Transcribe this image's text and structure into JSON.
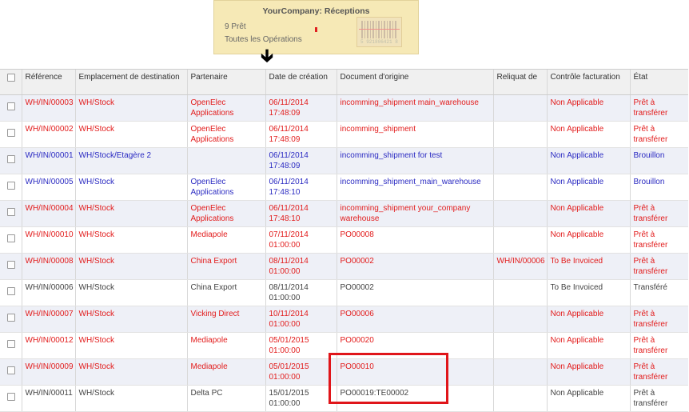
{
  "card": {
    "title": "YourCompany: Réceptions",
    "ready": "9 Prêt",
    "all_ops": "Toutes les Opérations",
    "barcode_number": "5 921806421 8"
  },
  "table": {
    "headers": {
      "reference": "Référence",
      "destination": "Emplacement de destination",
      "partner": "Partenaire",
      "created": "Date de création",
      "origin": "Document d'origine",
      "backorder": "Reliquat de",
      "invoice": "Contrôle facturation",
      "state": "État"
    },
    "rows": [
      {
        "color": "red",
        "reference": "WH/IN/00003",
        "destination": "WH/Stock",
        "partner": "OpenElec Applications",
        "created": "06/11/2014 17:48:09",
        "origin": "incomming_shipment main_warehouse",
        "backorder": "",
        "invoice": "Non Applicable",
        "state": "Prêt à transférer"
      },
      {
        "color": "red",
        "reference": "WH/IN/00002",
        "destination": "WH/Stock",
        "partner": "OpenElec Applications",
        "created": "06/11/2014 17:48:09",
        "origin": "incomming_shipment",
        "backorder": "",
        "invoice": "Non Applicable",
        "state": "Prêt à transférer"
      },
      {
        "color": "blue",
        "reference": "WH/IN/00001",
        "destination": "WH/Stock/Etagère 2",
        "partner": "",
        "created": "06/11/2014 17:48:09",
        "origin": "incomming_shipment for test",
        "backorder": "",
        "invoice": "Non Applicable",
        "state": "Brouillon"
      },
      {
        "color": "blue",
        "reference": "WH/IN/00005",
        "destination": "WH/Stock",
        "partner": "OpenElec Applications",
        "created": "06/11/2014 17:48:10",
        "origin": "incomming_shipment_main_warehouse",
        "backorder": "",
        "invoice": "Non Applicable",
        "state": "Brouillon"
      },
      {
        "color": "red",
        "reference": "WH/IN/00004",
        "destination": "WH/Stock",
        "partner": "OpenElec Applications",
        "created": "06/11/2014 17:48:10",
        "origin": "incomming_shipment your_company warehouse",
        "backorder": "",
        "invoice": "Non Applicable",
        "state": "Prêt à transférer"
      },
      {
        "color": "red",
        "reference": "WH/IN/00010",
        "destination": "WH/Stock",
        "partner": "Mediapole",
        "created": "07/11/2014 01:00:00",
        "origin": "PO00008",
        "backorder": "",
        "invoice": "Non Applicable",
        "state": "Prêt à transférer"
      },
      {
        "color": "red",
        "reference": "WH/IN/00008",
        "destination": "WH/Stock",
        "partner": "China Export",
        "created": "08/11/2014 01:00:00",
        "origin": "PO00002",
        "backorder": "WH/IN/00006",
        "invoice": "To Be Invoiced",
        "state": "Prêt à transférer"
      },
      {
        "color": "gray",
        "reference": "WH/IN/00006",
        "destination": "WH/Stock",
        "partner": "China Export",
        "created": "08/11/2014 01:00:00",
        "origin": "PO00002",
        "backorder": "",
        "invoice": "To Be Invoiced",
        "state": "Transféré"
      },
      {
        "color": "red",
        "reference": "WH/IN/00007",
        "destination": "WH/Stock",
        "partner": "Vicking Direct",
        "created": "10/11/2014 01:00:00",
        "origin": "PO00006",
        "backorder": "",
        "invoice": "Non Applicable",
        "state": "Prêt à transférer"
      },
      {
        "color": "red",
        "reference": "WH/IN/00012",
        "destination": "WH/Stock",
        "partner": "Mediapole",
        "created": "05/01/2015 01:00:00",
        "origin": "PO00020",
        "backorder": "",
        "invoice": "Non Applicable",
        "state": "Prêt à transférer"
      },
      {
        "color": "red",
        "reference": "WH/IN/00009",
        "destination": "WH/Stock",
        "partner": "Mediapole",
        "created": "05/01/2015 01:00:00",
        "origin": "PO00010",
        "backorder": "",
        "invoice": "Non Applicable",
        "state": "Prêt à transférer"
      },
      {
        "color": "gray",
        "reference": "WH/IN/00011",
        "destination": "WH/Stock",
        "partner": "Delta PC",
        "created": "15/01/2015 01:00:00",
        "origin": "PO00019:TE00002",
        "backorder": "",
        "invoice": "Non Applicable",
        "state": "Prêt à transférer"
      }
    ]
  }
}
